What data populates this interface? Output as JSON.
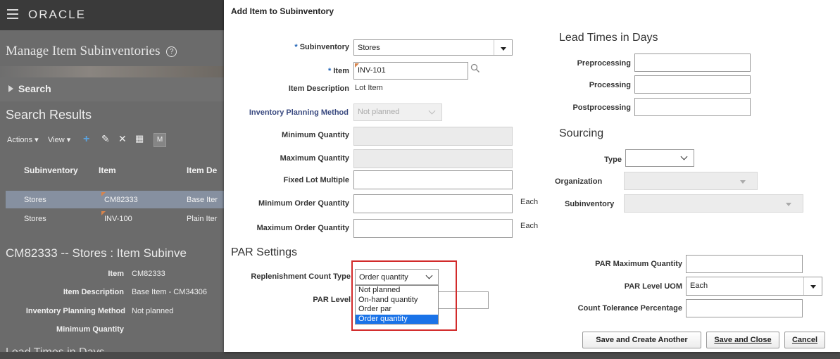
{
  "background": {
    "brand": "ORACLE",
    "page_title": "Manage Item Subinventories",
    "help_icon": "help-circle-icon",
    "search_label": "Search",
    "results_title": "Search Results",
    "toolbar": {
      "actions": "Actions",
      "view": "View",
      "extra": "M"
    },
    "table": {
      "headers": [
        "Subinventory",
        "Item",
        "Item De"
      ],
      "rows": [
        [
          "Stores",
          "CM82333",
          "Base Iter"
        ],
        [
          "Stores",
          "INV-100",
          "Plain Iter"
        ]
      ]
    },
    "detail_title": "CM82333 -- Stores : Item Subinve",
    "detail": {
      "item_label": "Item",
      "item_value": "CM82333",
      "desc_label": "Item Description",
      "desc_value": "Base Item - CM34306",
      "ipm_label": "Inventory Planning Method",
      "ipm_value": "Not planned",
      "minq_label": "Minimum Quantity"
    },
    "lead_times": "Lead Times in Days"
  },
  "dialog": {
    "title": "Add Item to Subinventory",
    "required_mark": "*",
    "subinventory_label": "Subinventory",
    "subinventory_value": "Stores",
    "item_label": "Item",
    "item_value": "INV-101",
    "item_desc_label": "Item Description",
    "item_desc_value": "Lot Item",
    "ipm_label": "Inventory Planning Method",
    "ipm_value": "Not planned",
    "min_qty_label": "Minimum Quantity",
    "max_qty_label": "Maximum Quantity",
    "fixed_lot_label": "Fixed Lot Multiple",
    "min_order_label": "Minimum Order Quantity",
    "max_order_label": "Maximum Order Quantity",
    "unit_each": "Each",
    "par_heading": "PAR Settings",
    "repl_label": "Replenishment Count Type",
    "repl_value": "Order quantity",
    "repl_options": [
      "Not planned",
      "On-hand quantity",
      "Order par",
      "Order quantity"
    ],
    "par_level_label": "PAR Level",
    "lead_heading": "Lead Times in Days",
    "preproc_label": "Preprocessing",
    "proc_label": "Processing",
    "postproc_label": "Postprocessing",
    "sourcing_heading": "Sourcing",
    "type_label": "Type",
    "org_label": "Organization",
    "src_sub_label": "Subinventory",
    "par_max_label": "PAR Maximum Quantity",
    "par_uom_label": "PAR Level UOM",
    "par_uom_value": "Each",
    "count_tol_label": "Count Tolerance Percentage",
    "buttons": {
      "save_create": "Save and Create Another",
      "save_close": "Save and Close",
      "cancel": "Cancel"
    }
  },
  "colors": {
    "accent": "#1a73e8",
    "highlight": "#d22b2b",
    "required": "#1a5fb4"
  }
}
